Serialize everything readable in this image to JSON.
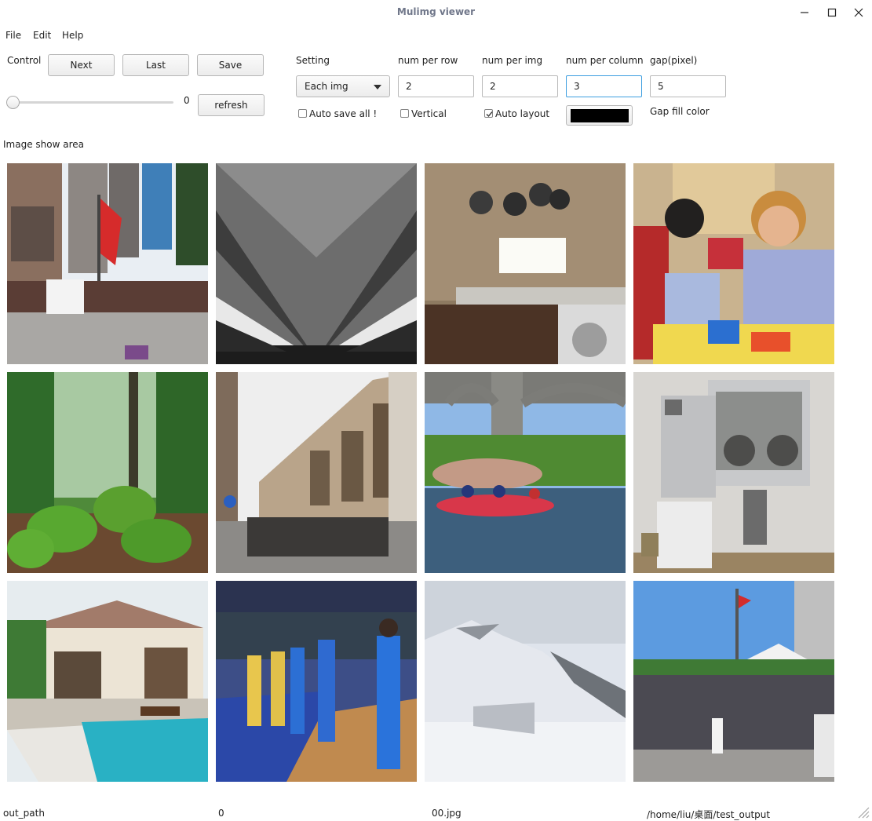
{
  "window": {
    "title": "Mulimg viewer"
  },
  "menu": [
    "File",
    "Edit",
    "Help"
  ],
  "control": {
    "label": "Control",
    "next": "Next",
    "last": "Last",
    "save": "Save",
    "slider_value": "0",
    "refresh": "refresh"
  },
  "setting": {
    "label": "Setting",
    "mode_selected": "Each img",
    "num_per_row_label": "num per row",
    "num_per_img_label": "num per img",
    "num_per_column_label": "num per column",
    "gap_label": "gap(pixel)",
    "num_per_row": "2",
    "num_per_img": "2",
    "num_per_column": "3",
    "gap": "5",
    "auto_save_all": {
      "label": "Auto save all !",
      "checked": false
    },
    "vertical": {
      "label": "Vertical",
      "checked": false
    },
    "auto_layout": {
      "label": "Auto layout",
      "checked": true
    },
    "gap_fill_color": "#000000",
    "gap_fill_color_label": "Gap fill color"
  },
  "image_area": {
    "label": "Image show area"
  },
  "status_bar": [
    "out_path",
    "0",
    "00.jpg",
    "/home/liu/桌面/test_output"
  ],
  "icons": {
    "minimize": "minimize-icon",
    "maximize": "maximize-icon",
    "close": "close-icon",
    "combo_arrow": "chevron-down-icon",
    "check": "checkmark-icon",
    "size_grip": "resize-grip-icon"
  }
}
